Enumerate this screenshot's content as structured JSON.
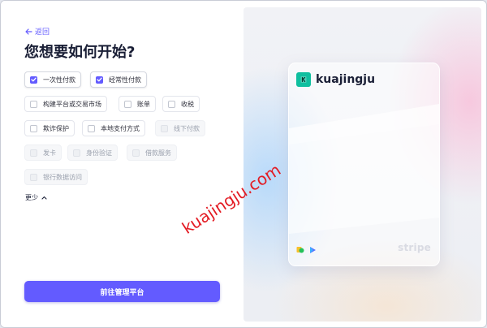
{
  "header": {
    "back_label": "返回",
    "title": "您想要如何开始?"
  },
  "options": [
    {
      "label": "一次性付款",
      "checked": true,
      "disabled": false
    },
    {
      "label": "经常性付款",
      "checked": true,
      "disabled": false
    },
    {
      "label": "构建平台或交易市场",
      "checked": false,
      "disabled": false
    },
    {
      "label": "账单",
      "checked": false,
      "disabled": false
    },
    {
      "label": "收税",
      "checked": false,
      "disabled": false
    },
    {
      "label": "欺诈保护",
      "checked": false,
      "disabled": false
    },
    {
      "label": "本地支付方式",
      "checked": false,
      "disabled": false
    },
    {
      "label": "线下付款",
      "checked": false,
      "disabled": true
    },
    {
      "label": "发卡",
      "checked": false,
      "disabled": true
    },
    {
      "label": "身份验证",
      "checked": false,
      "disabled": true
    },
    {
      "label": "借款服务",
      "checked": false,
      "disabled": true
    },
    {
      "label": "银行数据访问",
      "checked": false,
      "disabled": true
    }
  ],
  "more_label": "更少",
  "cta_label": "前往管理平台",
  "preview": {
    "business_name": "kuajingju",
    "logo_letter": "K",
    "brand_word": "stripe"
  },
  "watermark": "kuajingju.com",
  "colors": {
    "accent": "#635bff",
    "logo": "#0fbf9f",
    "watermark": "#e31b23"
  },
  "icons": {
    "back": "arrow-left-icon",
    "check": "check-icon",
    "chevron": "chevron-up-icon"
  }
}
